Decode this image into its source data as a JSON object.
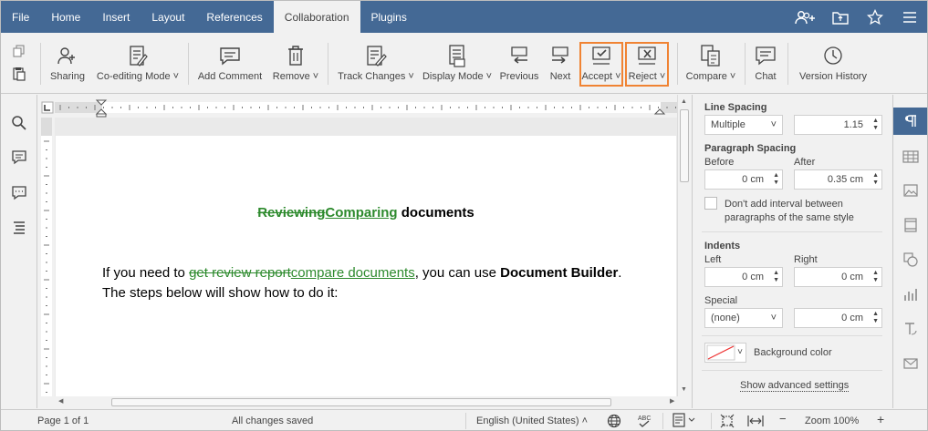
{
  "menubar": {
    "tabs": [
      {
        "label": "File",
        "active": false
      },
      {
        "label": "Home",
        "active": false
      },
      {
        "label": "Insert",
        "active": false
      },
      {
        "label": "Layout",
        "active": false
      },
      {
        "label": "References",
        "active": false
      },
      {
        "label": "Collaboration",
        "active": true
      },
      {
        "label": "Plugins",
        "active": false
      }
    ],
    "right_icons": [
      "add-user-icon",
      "folder-open-icon",
      "star-icon",
      "hamburger-menu-icon"
    ]
  },
  "toolbar": {
    "sharing": "Sharing",
    "coediting_mode": "Co-editing Mode",
    "add_comment": "Add Comment",
    "remove": "Remove",
    "track_changes": "Track Changes",
    "display_mode": "Display Mode",
    "previous": "Previous",
    "next": "Next",
    "accept": "Accept",
    "reject": "Reject",
    "compare": "Compare",
    "chat": "Chat",
    "version_history": "Version History",
    "highlight_color": "#f08333"
  },
  "leftbar": {
    "icons": [
      "search-icon",
      "comments-icon",
      "chat-icon",
      "navigation-icon"
    ]
  },
  "document": {
    "title_deleted": "Reviewing",
    "title_inserted": "Comparing",
    "title_rest": " documents",
    "para_1": "If you need to ",
    "para_deleted": "get review report",
    "para_inserted": "compare documents",
    "para_2": ", you can use ",
    "para_bold": "Document Builder",
    "para_3": ".",
    "para_line2": "The steps below will show how to do it:",
    "track_color": "#2d8a2d"
  },
  "panel": {
    "line_spacing_label": "Line Spacing",
    "line_spacing_mode": "Multiple",
    "line_spacing_value": "1.15",
    "paragraph_spacing_label": "Paragraph Spacing",
    "before_label": "Before",
    "before_value": "0 cm",
    "after_label": "After",
    "after_value": "0.35 cm",
    "dont_add_interval_1": "Don't add interval between",
    "dont_add_interval_2": "paragraphs of the same style",
    "indents_label": "Indents",
    "left_label": "Left",
    "left_value": "0 cm",
    "right_label": "Right",
    "right_value": "0 cm",
    "special_label": "Special",
    "special_mode": "(none)",
    "special_value": "0 cm",
    "background_color_label": "Background color",
    "advanced_settings": "Show advanced settings"
  },
  "right_tabs": [
    "paragraph-icon",
    "table-icon",
    "image-icon",
    "header-footer-icon",
    "shape-icon",
    "chart-icon",
    "text-art-icon",
    "mail-merge-icon"
  ],
  "statusbar": {
    "page_info": "Page 1 of 1",
    "save_status": "All changes saved",
    "language": "English (United States)",
    "zoom": "Zoom 100%",
    "accent": "#446995"
  }
}
